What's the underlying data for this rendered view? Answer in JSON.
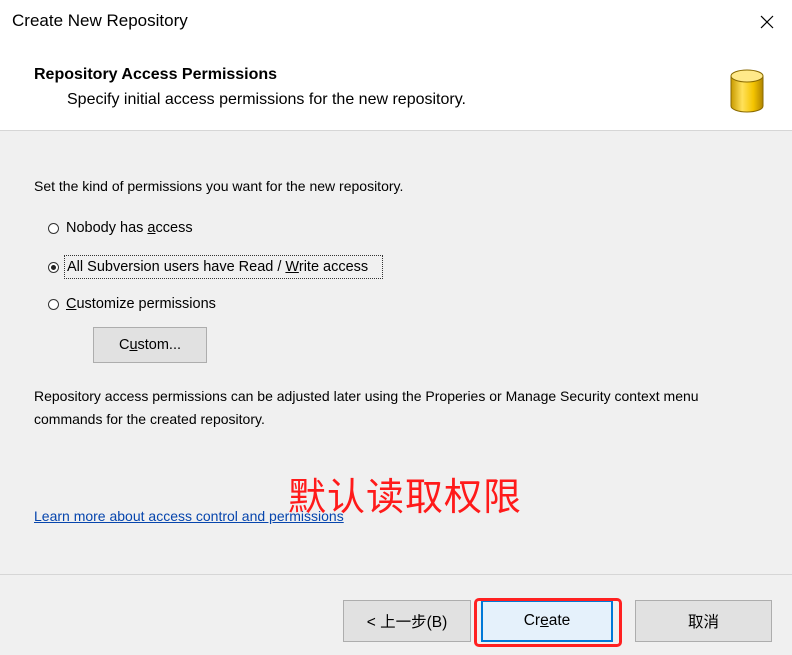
{
  "window": {
    "title": "Create New Repository",
    "close_glyph": "×"
  },
  "header": {
    "title": "Repository Access Permissions",
    "subtitle": "Specify initial access permissions for the new repository.",
    "icon": "database-icon"
  },
  "body": {
    "intro": "Set the kind of permissions you want for the new repository.",
    "options": [
      {
        "label_pre": "Nobody has ",
        "mnemonic": "a",
        "label_post": "ccess",
        "checked": false
      },
      {
        "label_pre": "All Subversion users have Read / ",
        "mnemonic": "W",
        "label_post": "rite access",
        "checked": true
      },
      {
        "label_pre": "",
        "mnemonic": "C",
        "label_post": "ustomize permissions",
        "checked": false
      }
    ],
    "custom_button": {
      "pre": "C",
      "mnemonic": "u",
      "post": "stom..."
    },
    "note": "Repository access permissions can be adjusted later using the Properies or Manage Security context menu commands for the created repository.",
    "link": "Learn more about access control and permissions",
    "annotation": "默认读取权限"
  },
  "footer": {
    "back_label": "< 上一步(B)",
    "create": {
      "pre": "Cr",
      "mnemonic": "e",
      "post": "ate"
    },
    "cancel_label": "取消"
  },
  "colors": {
    "accent": "#0078d7",
    "annotation_red": "#ff1a1a",
    "link": "#0645ad"
  }
}
